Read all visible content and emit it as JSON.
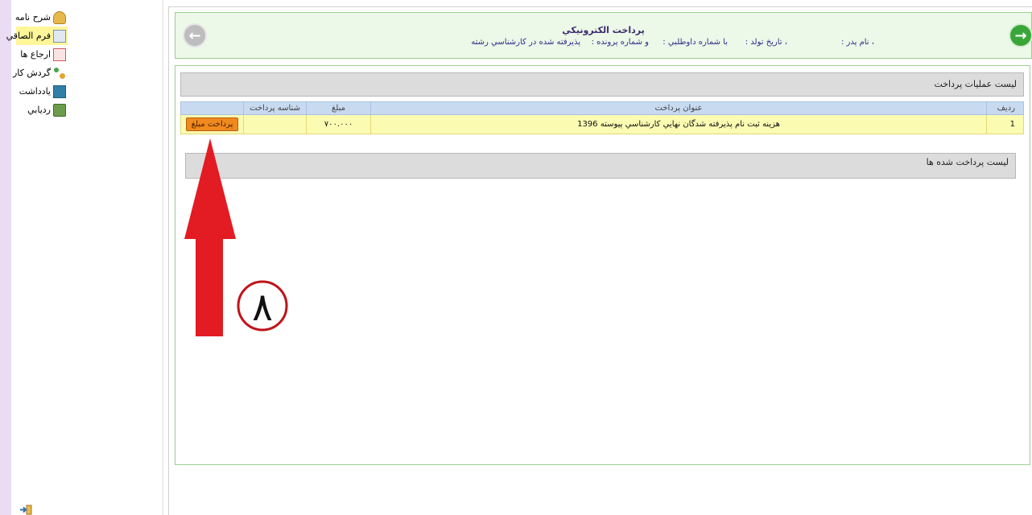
{
  "sidebar": {
    "items": [
      {
        "label": "شرح نامه",
        "icon": "envelope-icon",
        "active": false
      },
      {
        "label": "فرم الصاقي",
        "icon": "document-icon",
        "active": true
      },
      {
        "label": "ارجاع ها",
        "icon": "referral-icon",
        "active": false
      },
      {
        "label": "گردش کار",
        "icon": "workflow-icon",
        "active": false
      },
      {
        "label": "يادداشت",
        "icon": "note-icon",
        "active": false
      },
      {
        "label": "رديابي",
        "icon": "tracking-icon",
        "active": false
      }
    ],
    "logout_icon": "logout-icon"
  },
  "header": {
    "title": "پرداخت الكترونيكي",
    "fields": {
      "father_name": "، نام پدر :",
      "birth_date": "، تاريخ تولد :",
      "applicant_no": "با شماره داوطلبي :",
      "file_no": "و شماره پرونده :",
      "accepted": "پذيرفته شده در كارشناسي رشته"
    },
    "back_icon": "arrow-left-icon",
    "forward_icon": "arrow-right-icon"
  },
  "payments": {
    "section_title": "ليست عمليات پرداخت",
    "columns": {
      "row": "رديف",
      "title": "عنوان پرداخت",
      "amount": "مبلغ",
      "payment_id": "شناسه پرداخت"
    },
    "rows": [
      {
        "row": "1",
        "title": "هزينه ثبت نام پذيرفته شدگان نهايي كارشناسي پيوسته 1396",
        "amount": "۷۰۰.۰۰۰",
        "payment_id": "",
        "pay_button": "پرداخت مبلغ"
      }
    ]
  },
  "paid": {
    "section_title": "ليست پرداخت شده ها"
  },
  "annotation": {
    "step_number": "۸",
    "arrow_color": "#e31b23",
    "circle_color": "#c0121a"
  },
  "colors": {
    "header_bg": "#ecf8e8",
    "table_header_bg": "#c7daf0",
    "row_bg": "#fbfbb2",
    "pay_button_bg": "#f08a1f"
  }
}
